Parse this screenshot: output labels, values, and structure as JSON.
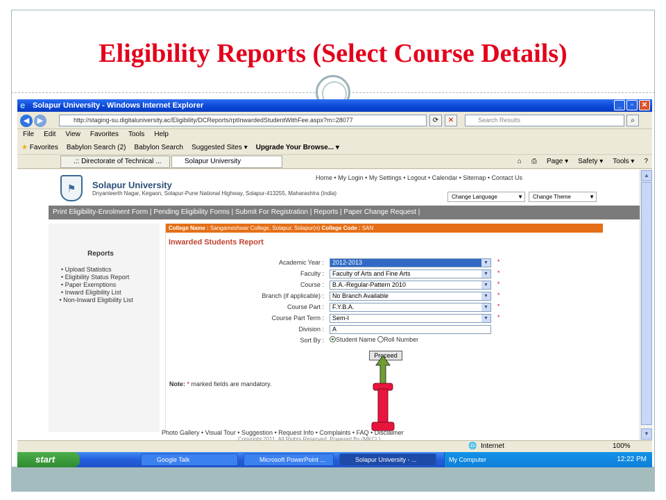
{
  "slide": {
    "title": "Eligibility Reports (Select Course Details)"
  },
  "browser": {
    "window_title": "Solapur University - Windows Internet Explorer",
    "url": "http://staging-su.digitaluniversity.ac/Eligibility/DCReports/rptInwardedStudentWithFee.aspx?m=28077",
    "search_placeholder": "Search Results",
    "menu": [
      "File",
      "Edit",
      "View",
      "Favorites",
      "Tools",
      "Help"
    ],
    "favorites": {
      "label": "Favorites",
      "items": [
        "Babylon Search (2)",
        "Babylon Search",
        "Suggested Sites ▾",
        "Upgrade Your Browse... ▾"
      ]
    },
    "tabs": [
      ".:: Directorate of Technical ...",
      "Solapur University"
    ],
    "commands": [
      "Page ▾",
      "Safety ▾",
      "Tools ▾"
    ],
    "status": {
      "zone": "Internet",
      "zoom": "100%"
    }
  },
  "site": {
    "name": "Solapur University",
    "address": "Dnyanteerth Nagar, Kegaon, Solapur-Pune National Highway, Solapur-413255, Maharashtra (India)",
    "top_links": "Home  • My Login  • My Settings  • Logout  • Calendar  • Sitemap  • Contact Us",
    "change_language": "Change Language",
    "change_theme": "Change Theme",
    "nav": "Print Eligibility-Enrolment Form | Pending Eligibility Forms | Submit For Registration | Reports | Paper Change Request |",
    "sidebar": {
      "title": "Reports",
      "items": [
        "Upload Statistics",
        "Eligibility Status Report",
        "Paper Exemptions",
        "Inward Eligibility List",
        "Non-Inward Eligibility List"
      ]
    },
    "college_label": "College Name :",
    "college_name": "Sangameshwar College, Solapur, Solapur(n)",
    "college_code_label": "College Code :",
    "college_code": "SAN",
    "report_title": "Inwarded Students Report",
    "form": {
      "academic_year": {
        "label": "Academic Year :",
        "value": "2012-2013"
      },
      "faculty": {
        "label": "Faculty :",
        "value": "Faculty of Arts and Fine Arts"
      },
      "course": {
        "label": "Course :",
        "value": "B.A.-Regular-Pattern 2010"
      },
      "branch": {
        "label": "Branch (if applicable) :",
        "value": "No Branch Available"
      },
      "course_part": {
        "label": "Course Part :",
        "value": "F.Y.B.A."
      },
      "course_part_term": {
        "label": "Course Part Term :",
        "value": "Sem-I"
      },
      "division": {
        "label": "Division :",
        "value": "A"
      },
      "sort_by": {
        "label": "Sort By :",
        "option1": "Student Name",
        "option2": "Roll Number"
      },
      "proceed": "Proceed",
      "required_mark": "*"
    },
    "note_label": "Note:",
    "note_text": "marked fields are mandatory.",
    "footer_links": "Photo Gallery   • Visual Tour   • Suggestion   • Request Info   • Complaints   • FAQ   • Disclaimer",
    "copyright": "Copyright 2011. All Rights Reserved. Powered By (MKCL)"
  },
  "taskbar": {
    "start": "start",
    "items": [
      "Google Talk",
      "Microsoft PowerPoint ...",
      "Solapur University - ..."
    ],
    "my_computer": "My Computer",
    "clock": "12:22 PM"
  },
  "colors": {
    "title_red": "#e3001b",
    "xp_blue": "#0a46d6",
    "college_bar": "#e46f16",
    "pointer": "#e8163e"
  }
}
